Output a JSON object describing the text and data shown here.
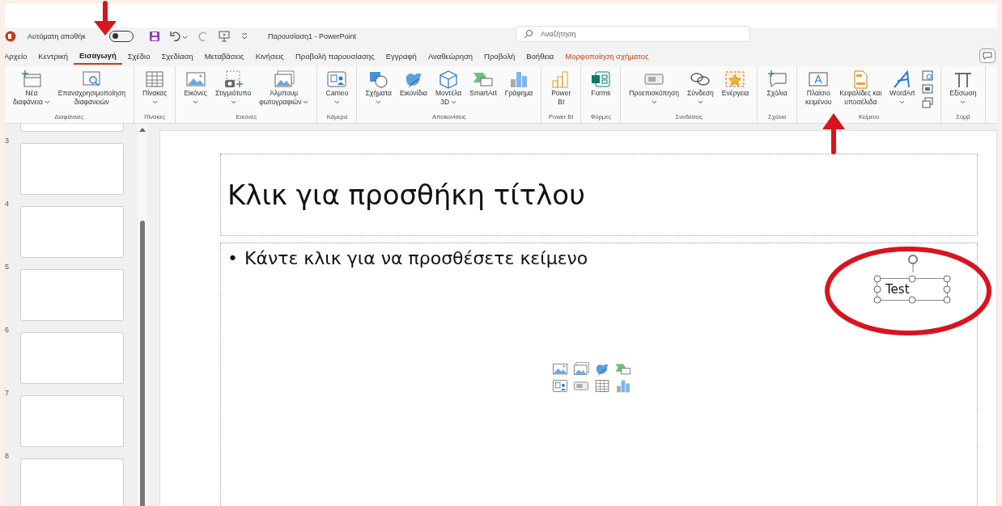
{
  "title_bar": {
    "autosave_label": "Αυτόματη αποθήκ",
    "autosave_on": false,
    "title": "Παρουσίαση1 - PowerPoint",
    "search": {
      "placeholder": "Αναζήτηση"
    }
  },
  "tabs": [
    {
      "label": "Αρχείο",
      "selected": false,
      "kind": "normal"
    },
    {
      "label": "Κεντρική",
      "selected": false,
      "kind": "normal"
    },
    {
      "label": "Εισαγωγή",
      "selected": true,
      "kind": "normal"
    },
    {
      "label": "Σχέδιο",
      "selected": false,
      "kind": "normal"
    },
    {
      "label": "Σχεδίαση",
      "selected": false,
      "kind": "normal"
    },
    {
      "label": "Μεταβάσεις",
      "selected": false,
      "kind": "normal"
    },
    {
      "label": "Κινήσεις",
      "selected": false,
      "kind": "normal"
    },
    {
      "label": "Προβολή παρουσίασης",
      "selected": false,
      "kind": "normal"
    },
    {
      "label": "Εγγραφή",
      "selected": false,
      "kind": "normal"
    },
    {
      "label": "Αναθεώρηση",
      "selected": false,
      "kind": "normal"
    },
    {
      "label": "Προβολή",
      "selected": false,
      "kind": "normal"
    },
    {
      "label": "Βοήθεια",
      "selected": false,
      "kind": "normal"
    },
    {
      "label": "Μορφοποίηση σχήματος",
      "selected": false,
      "kind": "contextual"
    }
  ],
  "ribbon": [
    {
      "label": "Διαφάνειες",
      "buttons": [
        {
          "lines": [
            "Νέα",
            "διαφάνεια"
          ],
          "dropdown": true
        },
        {
          "lines": [
            "Επαναχρησιμοποίηση",
            "διαφανειών"
          ],
          "dropdown": false
        }
      ]
    },
    {
      "label": "Πίνακες",
      "buttons": [
        {
          "lines": [
            "Πίνακας"
          ],
          "dropdown": true
        }
      ]
    },
    {
      "label": "Εικόνες",
      "buttons": [
        {
          "lines": [
            "Εικόνες"
          ],
          "dropdown": true
        },
        {
          "lines": [
            "Στιγμιότυπο"
          ],
          "dropdown": true
        },
        {
          "lines": [
            "Άλμπουμ",
            "φωτογραφιών"
          ],
          "dropdown": true
        }
      ]
    },
    {
      "label": "Κάμερα",
      "buttons": [
        {
          "lines": [
            "Cameo"
          ],
          "dropdown": true
        }
      ]
    },
    {
      "label": "Απεικονίσεις",
      "buttons": [
        {
          "lines": [
            "Σχήματα"
          ],
          "dropdown": true
        },
        {
          "lines": [
            "Εικονίδια"
          ],
          "dropdown": false
        },
        {
          "lines": [
            "Μοντέλα",
            "3D"
          ],
          "dropdown": true
        },
        {
          "lines": [
            "SmartArt"
          ],
          "dropdown": false
        },
        {
          "lines": [
            "Γράφημα"
          ],
          "dropdown": false
        }
      ]
    },
    {
      "label": "Power BI",
      "buttons": [
        {
          "lines": [
            "Power",
            "BI"
          ],
          "dropdown": false
        }
      ]
    },
    {
      "label": "Φόρμες",
      "buttons": [
        {
          "lines": [
            "Forms"
          ],
          "dropdown": false
        }
      ]
    },
    {
      "label": "Συνδέσεις",
      "buttons": [
        {
          "lines": [
            "Προεπισκόπηση"
          ],
          "dropdown": true
        },
        {
          "lines": [
            "Σύνδεση"
          ],
          "dropdown": true
        },
        {
          "lines": [
            "Ενέργεια"
          ],
          "dropdown": false
        }
      ]
    },
    {
      "label": "Σχόλια",
      "buttons": [
        {
          "lines": [
            "Σχόλια"
          ],
          "dropdown": false
        }
      ]
    },
    {
      "label": "Κείμενο",
      "buttons": [
        {
          "lines": [
            "Πλαίσιο",
            "κειμένου"
          ],
          "dropdown": false
        },
        {
          "lines": [
            "Κεφαλίδες και",
            "υποσέλιδα"
          ],
          "dropdown": false
        },
        {
          "lines": [
            "WordArt"
          ],
          "dropdown": true
        }
      ]
    },
    {
      "label": "Σύμβ",
      "buttons": [
        {
          "lines": [
            "Εξίσωση"
          ],
          "dropdown": true
        }
      ]
    }
  ],
  "slides": [
    {
      "number": "3"
    },
    {
      "number": "4"
    },
    {
      "number": "5"
    },
    {
      "number": "6"
    },
    {
      "number": "7"
    },
    {
      "number": "8"
    }
  ],
  "slide": {
    "title_placeholder": "Κλικ για προσθήκη τίτλου",
    "body_bullet": "•",
    "body_placeholder": "Κάντε κλικ για να προσθέσετε κείμενο",
    "text_box": {
      "text": "Test",
      "selected": true
    }
  }
}
